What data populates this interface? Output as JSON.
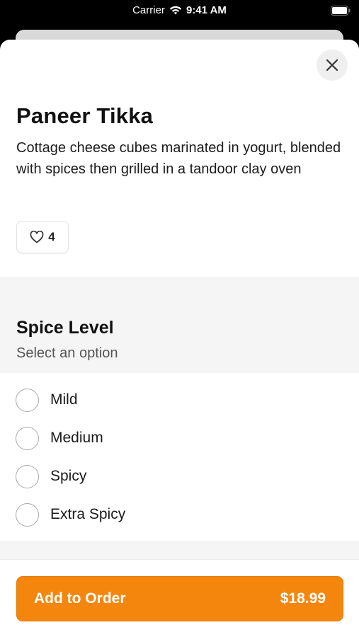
{
  "status_bar": {
    "carrier": "Carrier",
    "time": "9:41 AM"
  },
  "item": {
    "title": "Paneer Tikka",
    "description": "Cottage cheese cubes marinated in yogurt, blended with spices then grilled in a tandoor clay oven",
    "like_count": "4"
  },
  "option_group": {
    "title": "Spice Level",
    "subtitle": "Select an option",
    "options": [
      {
        "label": "Mild"
      },
      {
        "label": "Medium"
      },
      {
        "label": "Spicy"
      },
      {
        "label": "Extra Spicy"
      }
    ]
  },
  "footer": {
    "button_label": "Add to Order",
    "price": "$18.99"
  },
  "colors": {
    "accent": "#f5860d",
    "text": "#111111",
    "section_bg": "#f5f5f5"
  },
  "icons": {
    "close": "close-icon",
    "like": "heart-icon",
    "wifi": "wifi-icon",
    "battery": "battery-icon"
  }
}
